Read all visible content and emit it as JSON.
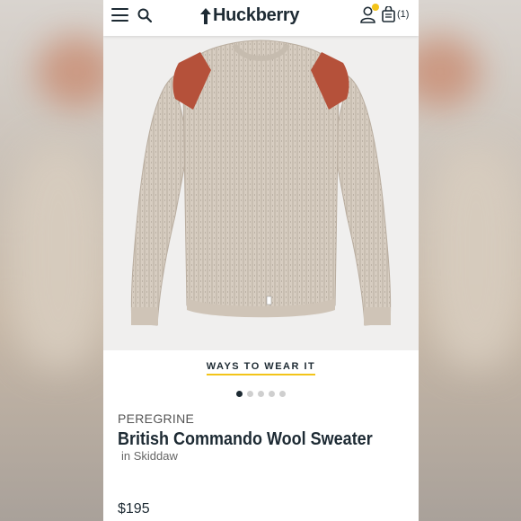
{
  "header": {
    "logo_text": "Huckberry",
    "cart_count": "(1)"
  },
  "product": {
    "ways_to_wear": "WAYS TO WEAR IT",
    "brand": "PEREGRINE",
    "name": "British Commando Wool Sweater",
    "color": "in Skiddaw",
    "price": "$195",
    "gallery_index": 1,
    "gallery_total": 5
  },
  "colors": {
    "navy": "#1d2a33",
    "accent_yellow": "#f3c419",
    "sweater_oatmeal": "#d6ccc0",
    "shoulder_patch": "#b5513a"
  }
}
